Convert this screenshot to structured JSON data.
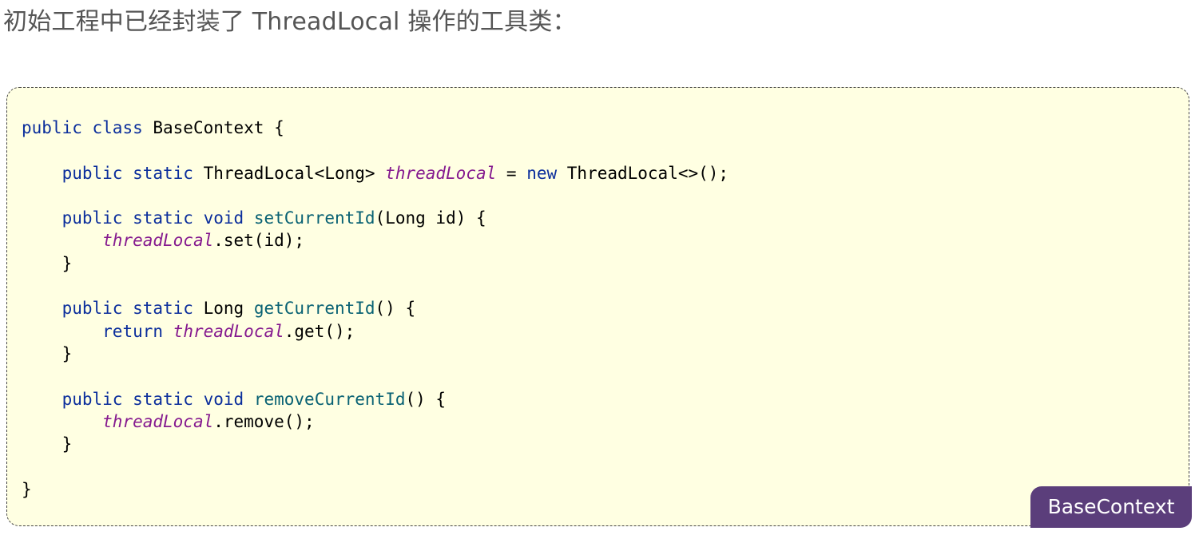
{
  "heading": {
    "text": "初始工程中已经封装了 ThreadLocal 操作的工具类："
  },
  "code_block": {
    "language_tag": "BaseContext",
    "lines": [
      {
        "tokens": [
          {
            "t": "public",
            "k": "kw"
          },
          {
            "t": " ",
            "k": "plain"
          },
          {
            "t": "class",
            "k": "kw"
          },
          {
            "t": " BaseContext {",
            "k": "plain"
          }
        ]
      },
      {
        "tokens": []
      },
      {
        "tokens": [
          {
            "t": "    ",
            "k": "plain"
          },
          {
            "t": "public",
            "k": "kw"
          },
          {
            "t": " ",
            "k": "plain"
          },
          {
            "t": "static",
            "k": "kw"
          },
          {
            "t": " ThreadLocal<Long> ",
            "k": "plain"
          },
          {
            "t": "threadLocal",
            "k": "fld"
          },
          {
            "t": " = ",
            "k": "plain"
          },
          {
            "t": "new",
            "k": "kw"
          },
          {
            "t": " ThreadLocal<>();",
            "k": "plain"
          }
        ]
      },
      {
        "tokens": []
      },
      {
        "tokens": [
          {
            "t": "    ",
            "k": "plain"
          },
          {
            "t": "public",
            "k": "kw"
          },
          {
            "t": " ",
            "k": "plain"
          },
          {
            "t": "static",
            "k": "kw"
          },
          {
            "t": " ",
            "k": "plain"
          },
          {
            "t": "void",
            "k": "kw"
          },
          {
            "t": " ",
            "k": "plain"
          },
          {
            "t": "setCurrentId",
            "k": "fn"
          },
          {
            "t": "(Long id) {",
            "k": "plain"
          }
        ]
      },
      {
        "tokens": [
          {
            "t": "        ",
            "k": "plain"
          },
          {
            "t": "threadLocal",
            "k": "fld"
          },
          {
            "t": ".set(id);",
            "k": "plain"
          }
        ]
      },
      {
        "tokens": [
          {
            "t": "    }",
            "k": "plain"
          }
        ]
      },
      {
        "tokens": []
      },
      {
        "tokens": [
          {
            "t": "    ",
            "k": "plain"
          },
          {
            "t": "public",
            "k": "kw"
          },
          {
            "t": " ",
            "k": "plain"
          },
          {
            "t": "static",
            "k": "kw"
          },
          {
            "t": " Long ",
            "k": "plain"
          },
          {
            "t": "getCurrentId",
            "k": "fn"
          },
          {
            "t": "() {",
            "k": "plain"
          }
        ]
      },
      {
        "tokens": [
          {
            "t": "        ",
            "k": "plain"
          },
          {
            "t": "return",
            "k": "kw"
          },
          {
            "t": " ",
            "k": "plain"
          },
          {
            "t": "threadLocal",
            "k": "fld"
          },
          {
            "t": ".get();",
            "k": "plain"
          }
        ]
      },
      {
        "tokens": [
          {
            "t": "    }",
            "k": "plain"
          }
        ]
      },
      {
        "tokens": []
      },
      {
        "tokens": [
          {
            "t": "    ",
            "k": "plain"
          },
          {
            "t": "public",
            "k": "kw"
          },
          {
            "t": " ",
            "k": "plain"
          },
          {
            "t": "static",
            "k": "kw"
          },
          {
            "t": " ",
            "k": "plain"
          },
          {
            "t": "void",
            "k": "kw"
          },
          {
            "t": " ",
            "k": "plain"
          },
          {
            "t": "removeCurrentId",
            "k": "fn"
          },
          {
            "t": "() {",
            "k": "plain"
          }
        ]
      },
      {
        "tokens": [
          {
            "t": "        ",
            "k": "plain"
          },
          {
            "t": "threadLocal",
            "k": "fld"
          },
          {
            "t": ".remove();",
            "k": "plain"
          }
        ]
      },
      {
        "tokens": [
          {
            "t": "    }",
            "k": "plain"
          }
        ]
      },
      {
        "tokens": []
      },
      {
        "tokens": [
          {
            "t": "}",
            "k": "plain"
          }
        ]
      }
    ]
  },
  "colors": {
    "keyword": "#0b2e9c",
    "method": "#086173",
    "field": "#851a8f",
    "code_background": "#ffffe2",
    "tag_background": "#5b3e7b",
    "heading_text": "#555555"
  }
}
